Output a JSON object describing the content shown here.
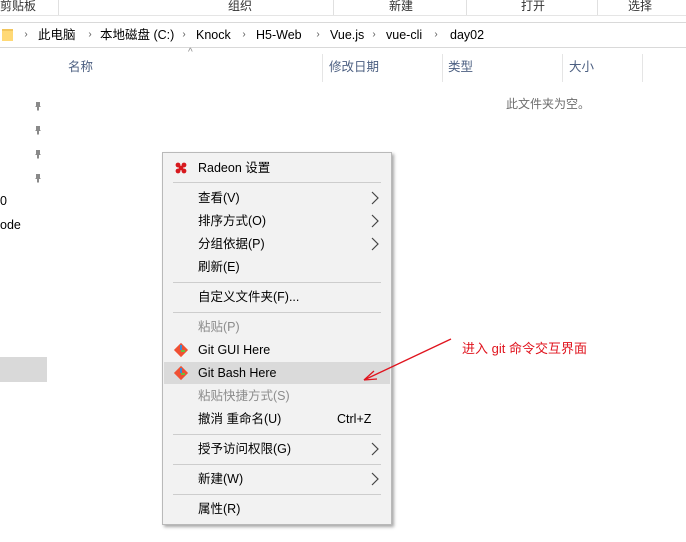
{
  "ribbon": {
    "groups": [
      "剪贴板",
      "组织",
      "新建",
      "打开",
      "选择"
    ]
  },
  "address": {
    "crumbs": [
      "此电脑",
      "本地磁盘 (C:)",
      "Knock",
      "H5-Web",
      "Vue.js",
      "vue-cli",
      "day02"
    ]
  },
  "columns": {
    "name": "名称",
    "modified": "修改日期",
    "type": "类型",
    "size": "大小"
  },
  "content": {
    "empty_message": "此文件夹为空。"
  },
  "nav": {
    "partial_labels": [
      "0",
      "ode"
    ]
  },
  "context_menu": {
    "radeon": "Radeon 设置",
    "view": "查看(V)",
    "sort": "排序方式(O)",
    "group": "分组依据(P)",
    "refresh": "刷新(E)",
    "customize": "自定义文件夹(F)...",
    "paste": "粘贴(P)",
    "git_gui": "Git GUI Here",
    "git_bash": "Git Bash Here",
    "paste_shortcut": "粘贴快捷方式(S)",
    "undo_rename": "撤消 重命名(U)",
    "undo_shortcut": "Ctrl+Z",
    "give_access": "授予访问权限(G)",
    "new": "新建(W)",
    "properties": "属性(R)"
  },
  "annotation": {
    "text": "进入 git 命令交互界面",
    "color": "#e0141e"
  },
  "colors": {
    "menu_bg": "#f2f2f2",
    "menu_highlight": "#dadada",
    "header_text": "#4d6082",
    "git_orange": "#f05033"
  }
}
